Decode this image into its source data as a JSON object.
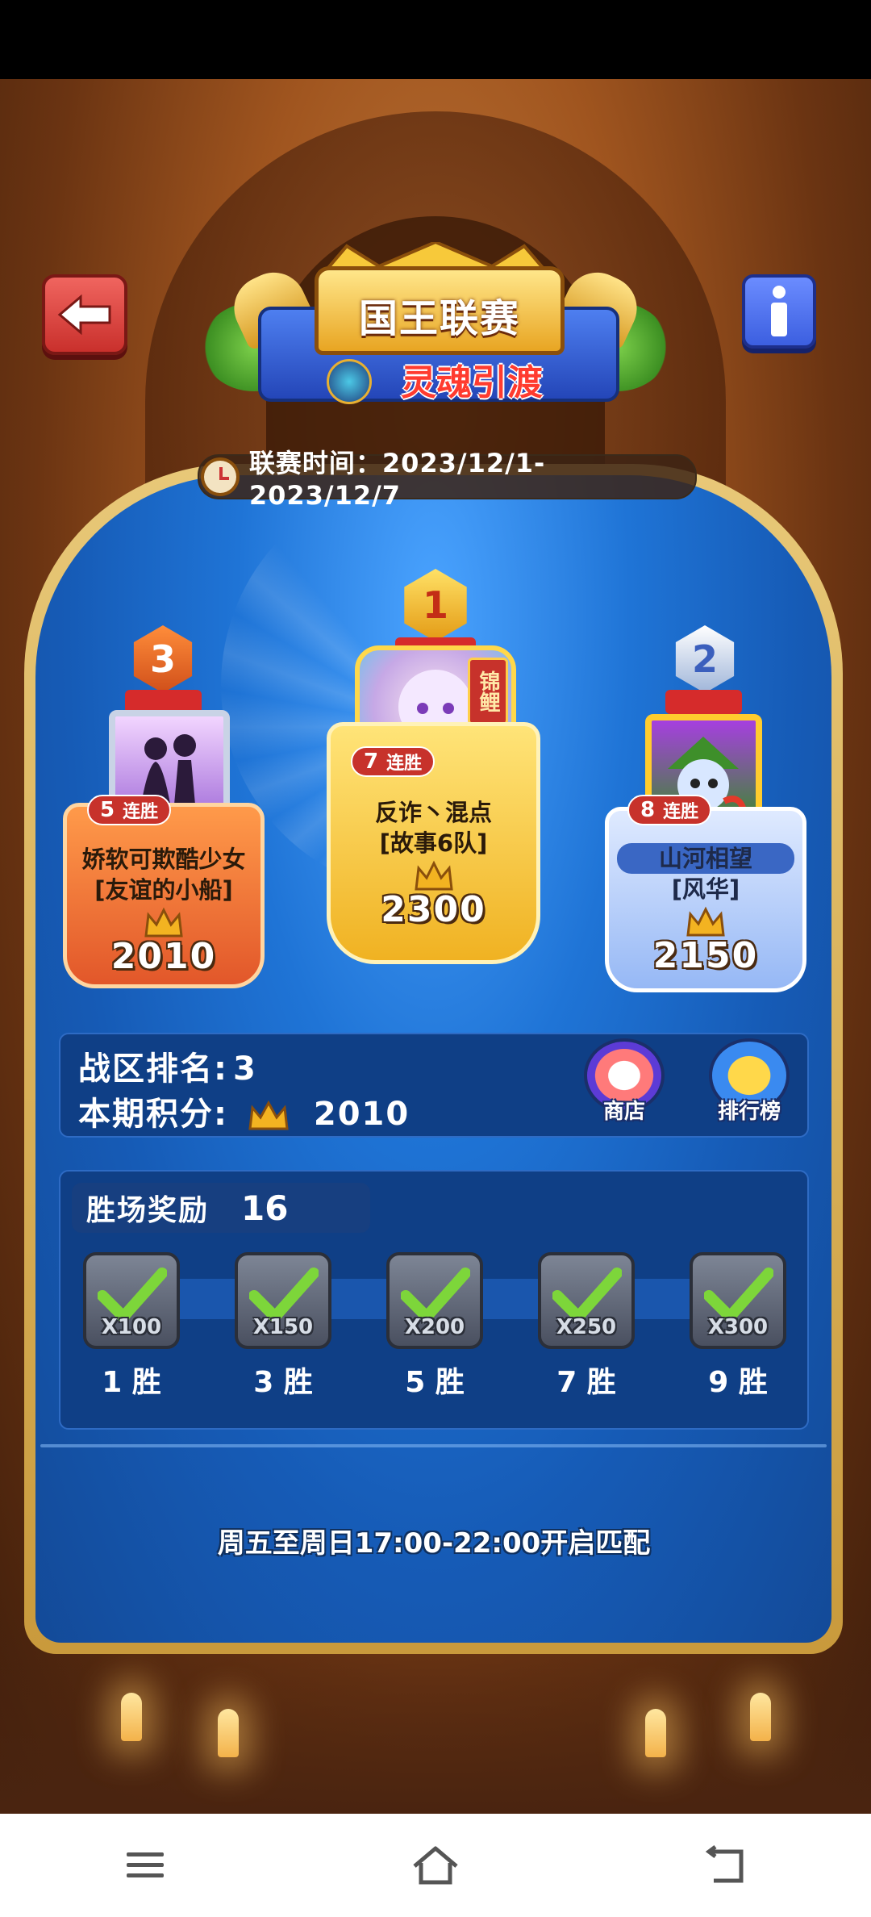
{
  "header": {
    "title_line1": "国王联赛",
    "title_line2": "灵魂引渡",
    "season_time": "联赛时间：2023/12/1-2023/12/7"
  },
  "podium": [
    {
      "rank": "1",
      "name_line1": "反诈丶混点",
      "name_line2": "[故事6队]",
      "score": "2300",
      "streak_n": "7",
      "streak_label": "连胜",
      "tag": "锦鲤"
    },
    {
      "rank": "2",
      "name_line1": "山河相望",
      "name_line2": "[风华]",
      "score": "2150",
      "streak_n": "8",
      "streak_label": "连胜"
    },
    {
      "rank": "3",
      "name_line1": "娇软可欺酷少女",
      "name_line2": "[友谊的小船]",
      "score": "2010",
      "streak_n": "5",
      "streak_label": "连胜"
    }
  ],
  "stats": {
    "rank_label": "战区排名:",
    "rank_value": "3",
    "points_label": "本期积分:",
    "points_value": "2010",
    "shop_label": "商店",
    "leaderboard_label": "排行榜"
  },
  "rewards": {
    "title": "胜场奖励",
    "count": "16",
    "items": [
      {
        "mult": "X100",
        "wins": "1 胜",
        "claimed": true
      },
      {
        "mult": "X150",
        "wins": "3 胜",
        "claimed": true
      },
      {
        "mult": "X200",
        "wins": "5 胜",
        "claimed": true
      },
      {
        "mult": "X250",
        "wins": "7 胜",
        "claimed": true
      },
      {
        "mult": "X300",
        "wins": "9 胜",
        "claimed": true
      }
    ]
  },
  "notice": "周五至周日17:00-22:00开启匹配",
  "icons": {
    "back": "back-arrow-icon",
    "info": "info-icon",
    "clock": "clock-icon",
    "crown": "crown-icon",
    "check": "checkmark-icon",
    "nav_menu": "menu-icon",
    "nav_home": "home-icon",
    "nav_back": "back-icon"
  },
  "colors": {
    "panel_blue": "#1f74d6",
    "gold": "#f0b222",
    "orange": "#e2572a",
    "silver_blue": "#96b8f5",
    "streak_red": "#c7322b",
    "check_green": "#7dd63a"
  }
}
